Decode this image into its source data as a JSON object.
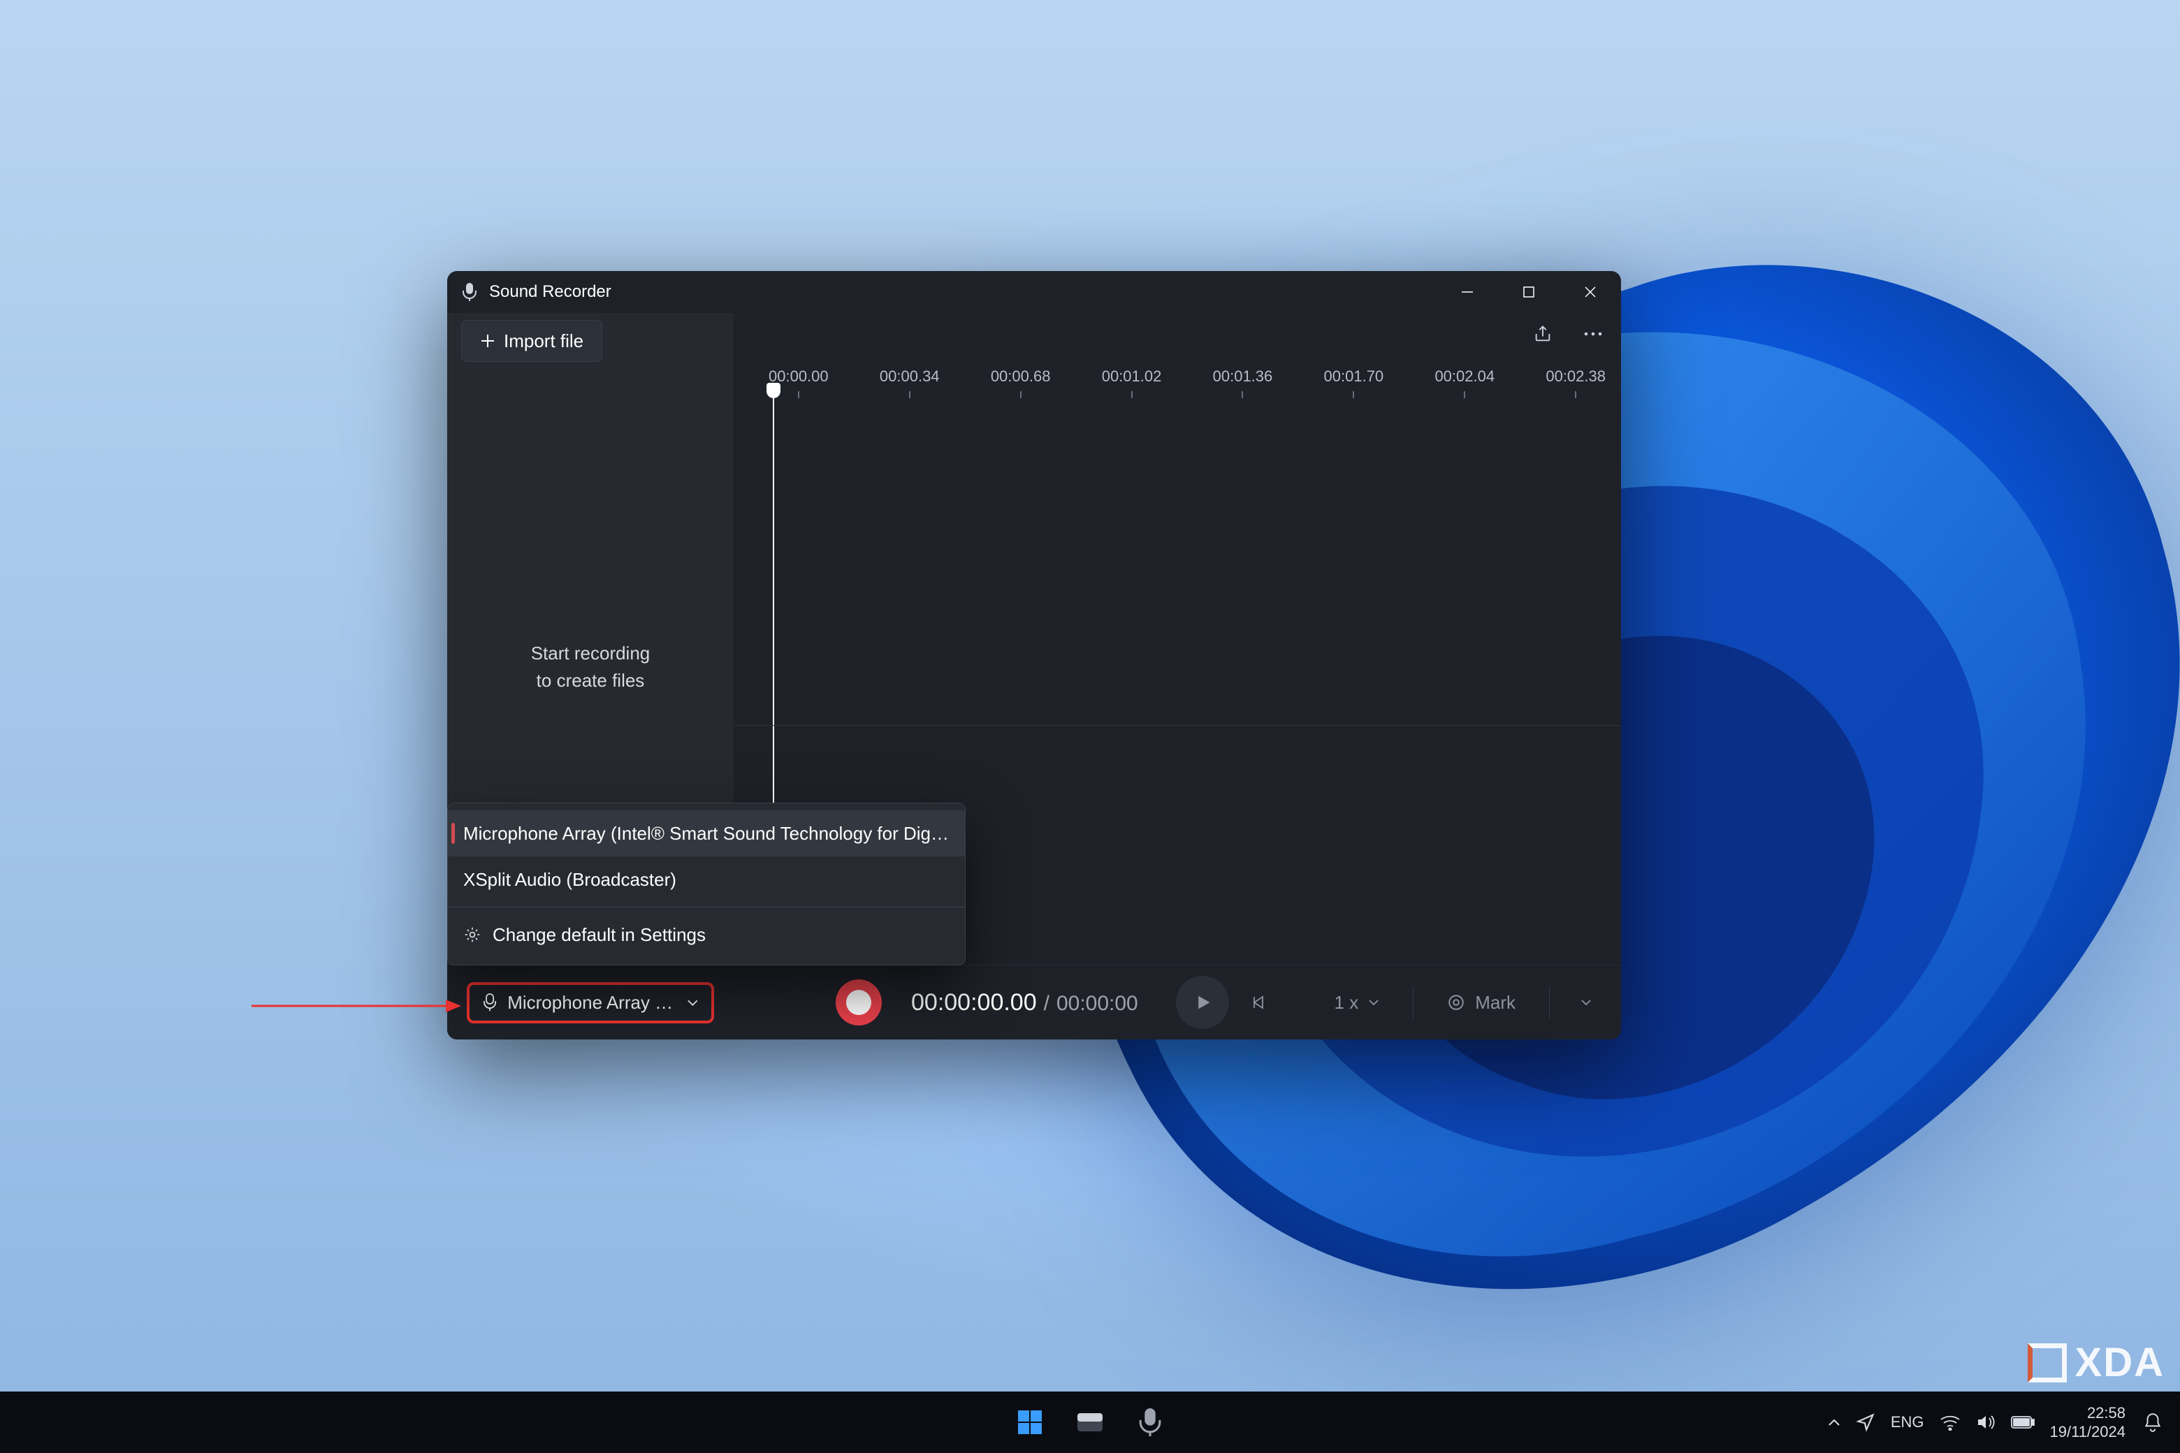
{
  "app": {
    "title": "Sound Recorder",
    "import_button": "Import file",
    "sidebar_empty_line1": "Start recording",
    "sidebar_empty_line2": "to create files"
  },
  "timeline": {
    "ticks": [
      "00:00.00",
      "00:00.34",
      "00:00.68",
      "00:01.02",
      "00:01.36",
      "00:01.70",
      "00:02.04",
      "00:02.38"
    ]
  },
  "mic_dropdown": {
    "options": [
      {
        "label": "Microphone Array (Intel® Smart Sound Technology for Digital Microph",
        "selected": true
      },
      {
        "label": "XSplit Audio (Broadcaster)",
        "selected": false
      }
    ],
    "settings_label": "Change default in Settings"
  },
  "controls": {
    "mic_selected_short": "Microphone Array (In...",
    "position": "00:00:00.00",
    "duration": "00:00:00",
    "speed_label": "1 x",
    "mark_label": "Mark"
  },
  "taskbar": {
    "time": "22:58",
    "date": "19/11/2024"
  },
  "watermark": {
    "brand": "XDA"
  }
}
